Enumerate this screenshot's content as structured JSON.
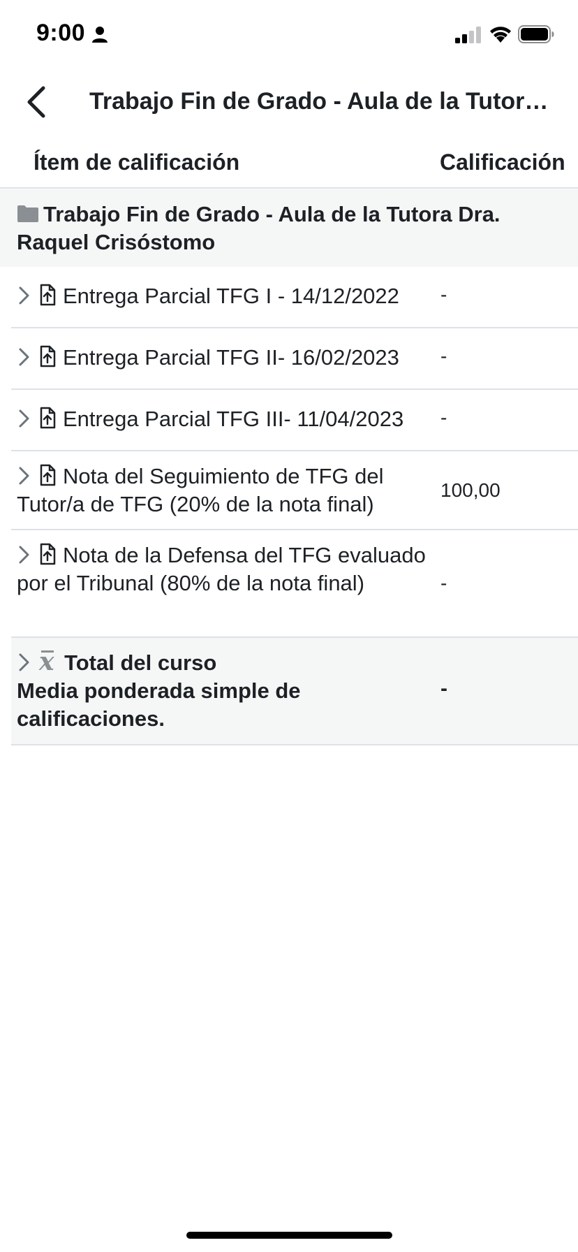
{
  "status_bar": {
    "time": "9:00"
  },
  "nav": {
    "title": "Trabajo Fin de Grado - Aula de la Tutora Dra. Raquel Crisóstomo"
  },
  "columns": {
    "item": "Ítem de calificación",
    "grade": "Calificación"
  },
  "category": {
    "title": "Trabajo Fin de Grado - Aula de la Tutora Dra. Raquel Crisóstomo"
  },
  "rows": [
    {
      "item": "Entrega Parcial TFG I - 14/12/2022",
      "grade": "-"
    },
    {
      "item": "Entrega Parcial TFG II- 16/02/2023",
      "grade": "-"
    },
    {
      "item": "Entrega Parcial TFG III- 11/04/2023",
      "grade": "-"
    },
    {
      "item": "Nota del Seguimiento de TFG del Tutor/a de TFG (20% de la nota final)",
      "grade": "100,00"
    },
    {
      "item": "Nota de la Defensa del TFG evaluado por el Tribunal (80% de la nota final)",
      "grade": "-"
    }
  ],
  "total": {
    "title": "Total del curso",
    "description": "Media ponderada simple de calificaciones.",
    "grade": "-"
  },
  "icons": {
    "back": "chevron-left-icon",
    "category": "folder-icon",
    "row_expand": "chevron-right-icon",
    "assignment": "assignment-upload-icon",
    "total": "mean-xbar-icon"
  },
  "colors": {
    "text": "#1d2125",
    "category_bg": "#f5f6f6",
    "divider": "#dee2e6",
    "icon_gray": "#8a8f94"
  }
}
